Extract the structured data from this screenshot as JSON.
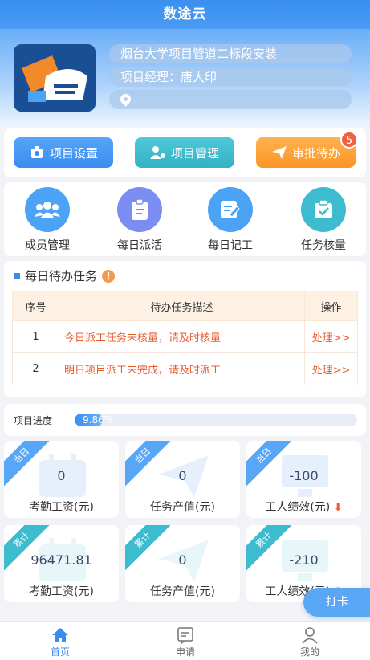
{
  "app": {
    "title": "数途云"
  },
  "header": {
    "project_name": "烟台大学项目管道二标段安装",
    "manager": "项目经理：唐大印",
    "location": ""
  },
  "actions": {
    "project_settings": "项目设置",
    "project_management": "项目管理",
    "pending_approval": "审批待办",
    "pending_count": "5"
  },
  "menu": [
    {
      "label": "成员管理",
      "icon": "members-icon",
      "color": "#4aa3f5"
    },
    {
      "label": "每日派活",
      "icon": "clipboard-icon",
      "color": "#7b8cf2"
    },
    {
      "label": "每日记工",
      "icon": "edit-note-icon",
      "color": "#4aa3f5"
    },
    {
      "label": "任务核量",
      "icon": "task-check-icon",
      "color": "#3dbcd0"
    }
  ],
  "todo": {
    "title": "每日待办任务",
    "columns": [
      "序号",
      "待办任务描述",
      "操作"
    ],
    "rows": [
      {
        "no": "1",
        "desc": "今日派工任务未核量，请及时核量",
        "action": "处理>>"
      },
      {
        "no": "2",
        "desc": "明日项目派工未完成，请及时派工",
        "action": "处理>>"
      }
    ]
  },
  "progress": {
    "label": "项目进度",
    "value": "9.86%",
    "fraction": 0.0986
  },
  "stats_today": {
    "tag": "当日",
    "items": [
      {
        "value": "0",
        "label": "考勤工资(元)"
      },
      {
        "value": "0",
        "label": "任务产值(元)"
      },
      {
        "value": "-100",
        "label": "工人绩效(元)"
      }
    ]
  },
  "stats_total": {
    "tag": "累计",
    "items": [
      {
        "value": "96471.81",
        "label": "考勤工资(元)"
      },
      {
        "value": "0",
        "label": "任务产值(元)"
      },
      {
        "value": "-210",
        "label": "工人绩效(元)"
      }
    ]
  },
  "float_button": "打卡",
  "tabs": [
    {
      "label": "首页",
      "icon": "home-icon"
    },
    {
      "label": "申请",
      "icon": "apply-icon"
    },
    {
      "label": "我的",
      "icon": "profile-icon"
    }
  ],
  "colors": {
    "primary": "#3b8cf0",
    "teal": "#32b2c6",
    "orange": "#fb9526",
    "alert": "#e85d30"
  }
}
